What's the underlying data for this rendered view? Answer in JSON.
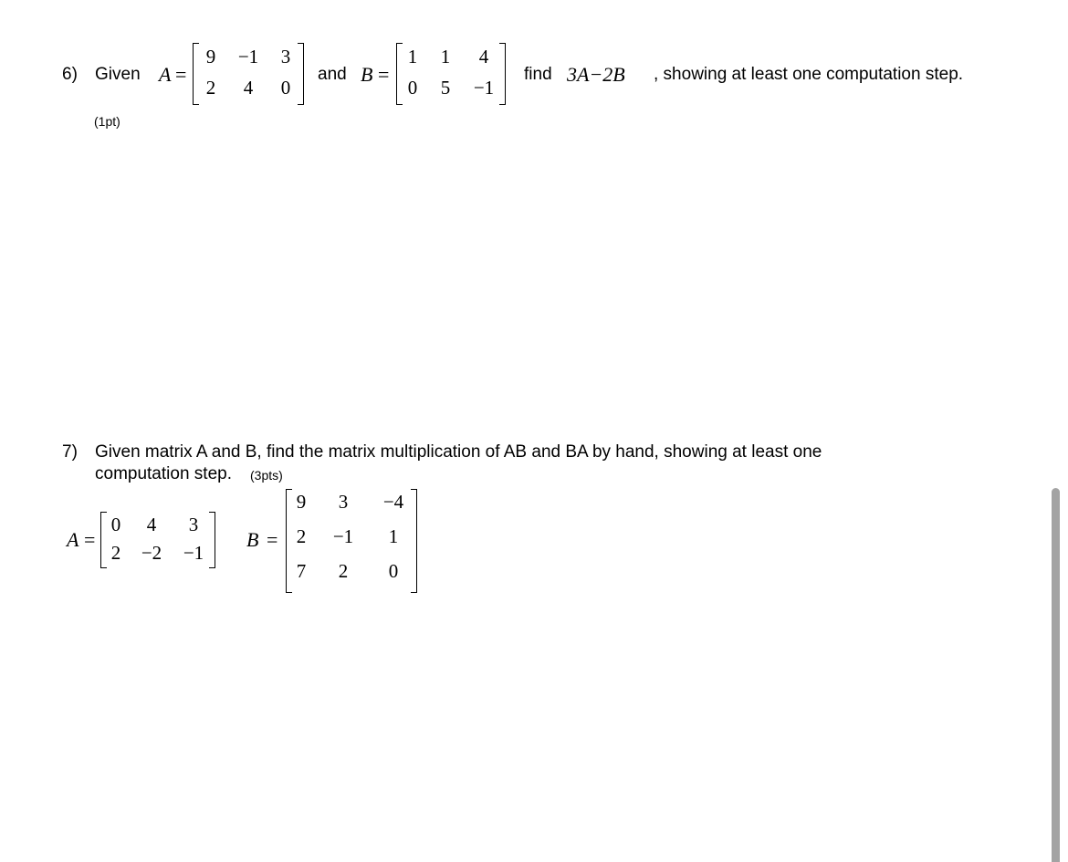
{
  "q6": {
    "number": "6)",
    "given": "Given",
    "a_label": "A",
    "equals": "=",
    "and": "and",
    "b_label": "B",
    "find": "find",
    "expr": "3A−2B",
    "suffix": ", showing at least one computation step.",
    "points": "(1pt)",
    "matrix_a": [
      [
        "9",
        "−1",
        "3"
      ],
      [
        "2",
        "4",
        "0"
      ]
    ],
    "matrix_b": [
      [
        "1",
        "1",
        "4"
      ],
      [
        "0",
        "5",
        "−1"
      ]
    ]
  },
  "q7": {
    "number": "7)",
    "line1": "Given matrix A and B, find the matrix multiplication of AB and BA by hand, showing at least one",
    "line2": "computation step.",
    "points": "(3pts)",
    "a_label": "A",
    "b_label": "B",
    "equals": "=",
    "matrix_a": [
      [
        "0",
        "4",
        "3"
      ],
      [
        "2",
        "−2",
        "−1"
      ]
    ],
    "matrix_b": [
      [
        "9",
        "3",
        "−4"
      ],
      [
        "2",
        "−1",
        "1"
      ],
      [
        "7",
        "2",
        "0"
      ]
    ]
  }
}
